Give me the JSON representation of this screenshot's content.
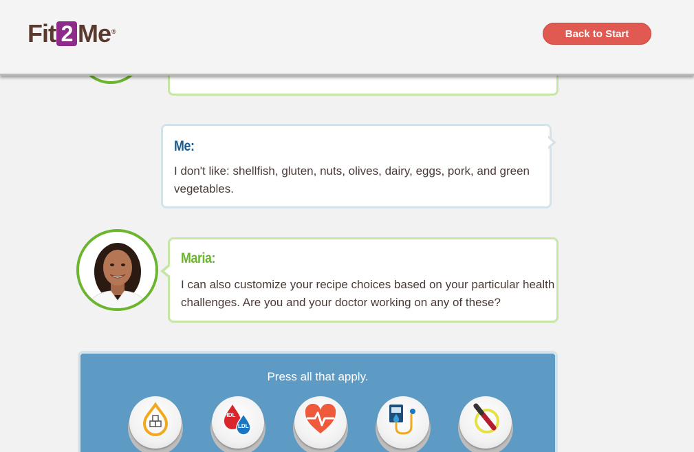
{
  "header": {
    "logo": {
      "part1": "Fit",
      "part2": "2",
      "part3": "Me",
      "reg": "®"
    },
    "back_button": "Back to Start"
  },
  "chat": {
    "partial_message": "",
    "me": {
      "speaker": "Me:",
      "message": "I don't like: shellfish, gluten, nuts, olives, dairy, eggs, pork, and green vegetables."
    },
    "maria": {
      "speaker": "Maria:",
      "message": "I can also customize your recipe choices based on your particular health challenges. Are you and your doctor working on any of these?"
    }
  },
  "options_panel": {
    "instruction": "Press all that apply.",
    "options": [
      {
        "icon": "sugar-cubes-drop-icon",
        "label_1": "",
        "label_2": ""
      },
      {
        "icon": "cholesterol-icon",
        "label_1": "HDL",
        "label_2": "LDL"
      },
      {
        "icon": "heart-rate-icon",
        "label_1": "",
        "label_2": ""
      },
      {
        "icon": "blood-pressure-monitor-icon",
        "label_1": "",
        "label_2": ""
      },
      {
        "icon": "no-thermometer-icon",
        "label_1": "",
        "label_2": ""
      }
    ]
  },
  "colors": {
    "brand_purple": "#8e2a8a",
    "back_button": "#e05a52",
    "maria_green": "#6cb52f",
    "me_blue": "#1e5b8e",
    "panel_blue": "#5d9ac4"
  }
}
